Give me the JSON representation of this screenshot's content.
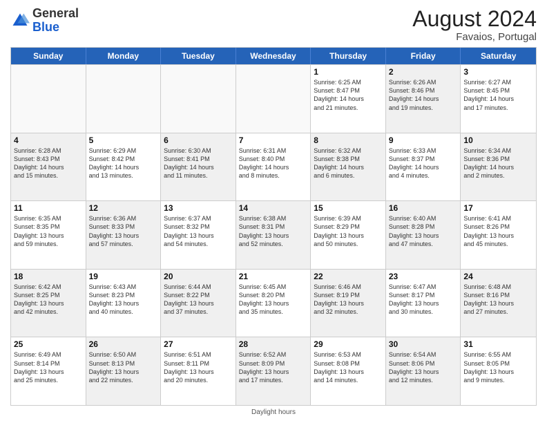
{
  "header": {
    "logo_general": "General",
    "logo_blue": "Blue",
    "month_year": "August 2024",
    "location": "Favaios, Portugal"
  },
  "footer": {
    "daylight_label": "Daylight hours"
  },
  "days_of_week": [
    "Sunday",
    "Monday",
    "Tuesday",
    "Wednesday",
    "Thursday",
    "Friday",
    "Saturday"
  ],
  "weeks": [
    [
      {
        "day": "",
        "info": "",
        "empty": true
      },
      {
        "day": "",
        "info": "",
        "empty": true
      },
      {
        "day": "",
        "info": "",
        "empty": true
      },
      {
        "day": "",
        "info": "",
        "empty": true
      },
      {
        "day": "1",
        "info": "Sunrise: 6:25 AM\nSunset: 8:47 PM\nDaylight: 14 hours\nand 21 minutes.",
        "shaded": false
      },
      {
        "day": "2",
        "info": "Sunrise: 6:26 AM\nSunset: 8:46 PM\nDaylight: 14 hours\nand 19 minutes.",
        "shaded": true
      },
      {
        "day": "3",
        "info": "Sunrise: 6:27 AM\nSunset: 8:45 PM\nDaylight: 14 hours\nand 17 minutes.",
        "shaded": false
      }
    ],
    [
      {
        "day": "4",
        "info": "Sunrise: 6:28 AM\nSunset: 8:43 PM\nDaylight: 14 hours\nand 15 minutes.",
        "shaded": true
      },
      {
        "day": "5",
        "info": "Sunrise: 6:29 AM\nSunset: 8:42 PM\nDaylight: 14 hours\nand 13 minutes.",
        "shaded": false
      },
      {
        "day": "6",
        "info": "Sunrise: 6:30 AM\nSunset: 8:41 PM\nDaylight: 14 hours\nand 11 minutes.",
        "shaded": true
      },
      {
        "day": "7",
        "info": "Sunrise: 6:31 AM\nSunset: 8:40 PM\nDaylight: 14 hours\nand 8 minutes.",
        "shaded": false
      },
      {
        "day": "8",
        "info": "Sunrise: 6:32 AM\nSunset: 8:38 PM\nDaylight: 14 hours\nand 6 minutes.",
        "shaded": true
      },
      {
        "day": "9",
        "info": "Sunrise: 6:33 AM\nSunset: 8:37 PM\nDaylight: 14 hours\nand 4 minutes.",
        "shaded": false
      },
      {
        "day": "10",
        "info": "Sunrise: 6:34 AM\nSunset: 8:36 PM\nDaylight: 14 hours\nand 2 minutes.",
        "shaded": true
      }
    ],
    [
      {
        "day": "11",
        "info": "Sunrise: 6:35 AM\nSunset: 8:35 PM\nDaylight: 13 hours\nand 59 minutes.",
        "shaded": false
      },
      {
        "day": "12",
        "info": "Sunrise: 6:36 AM\nSunset: 8:33 PM\nDaylight: 13 hours\nand 57 minutes.",
        "shaded": true
      },
      {
        "day": "13",
        "info": "Sunrise: 6:37 AM\nSunset: 8:32 PM\nDaylight: 13 hours\nand 54 minutes.",
        "shaded": false
      },
      {
        "day": "14",
        "info": "Sunrise: 6:38 AM\nSunset: 8:31 PM\nDaylight: 13 hours\nand 52 minutes.",
        "shaded": true
      },
      {
        "day": "15",
        "info": "Sunrise: 6:39 AM\nSunset: 8:29 PM\nDaylight: 13 hours\nand 50 minutes.",
        "shaded": false
      },
      {
        "day": "16",
        "info": "Sunrise: 6:40 AM\nSunset: 8:28 PM\nDaylight: 13 hours\nand 47 minutes.",
        "shaded": true
      },
      {
        "day": "17",
        "info": "Sunrise: 6:41 AM\nSunset: 8:26 PM\nDaylight: 13 hours\nand 45 minutes.",
        "shaded": false
      }
    ],
    [
      {
        "day": "18",
        "info": "Sunrise: 6:42 AM\nSunset: 8:25 PM\nDaylight: 13 hours\nand 42 minutes.",
        "shaded": true
      },
      {
        "day": "19",
        "info": "Sunrise: 6:43 AM\nSunset: 8:23 PM\nDaylight: 13 hours\nand 40 minutes.",
        "shaded": false
      },
      {
        "day": "20",
        "info": "Sunrise: 6:44 AM\nSunset: 8:22 PM\nDaylight: 13 hours\nand 37 minutes.",
        "shaded": true
      },
      {
        "day": "21",
        "info": "Sunrise: 6:45 AM\nSunset: 8:20 PM\nDaylight: 13 hours\nand 35 minutes.",
        "shaded": false
      },
      {
        "day": "22",
        "info": "Sunrise: 6:46 AM\nSunset: 8:19 PM\nDaylight: 13 hours\nand 32 minutes.",
        "shaded": true
      },
      {
        "day": "23",
        "info": "Sunrise: 6:47 AM\nSunset: 8:17 PM\nDaylight: 13 hours\nand 30 minutes.",
        "shaded": false
      },
      {
        "day": "24",
        "info": "Sunrise: 6:48 AM\nSunset: 8:16 PM\nDaylight: 13 hours\nand 27 minutes.",
        "shaded": true
      }
    ],
    [
      {
        "day": "25",
        "info": "Sunrise: 6:49 AM\nSunset: 8:14 PM\nDaylight: 13 hours\nand 25 minutes.",
        "shaded": false
      },
      {
        "day": "26",
        "info": "Sunrise: 6:50 AM\nSunset: 8:13 PM\nDaylight: 13 hours\nand 22 minutes.",
        "shaded": true
      },
      {
        "day": "27",
        "info": "Sunrise: 6:51 AM\nSunset: 8:11 PM\nDaylight: 13 hours\nand 20 minutes.",
        "shaded": false
      },
      {
        "day": "28",
        "info": "Sunrise: 6:52 AM\nSunset: 8:09 PM\nDaylight: 13 hours\nand 17 minutes.",
        "shaded": true
      },
      {
        "day": "29",
        "info": "Sunrise: 6:53 AM\nSunset: 8:08 PM\nDaylight: 13 hours\nand 14 minutes.",
        "shaded": false
      },
      {
        "day": "30",
        "info": "Sunrise: 6:54 AM\nSunset: 8:06 PM\nDaylight: 13 hours\nand 12 minutes.",
        "shaded": true
      },
      {
        "day": "31",
        "info": "Sunrise: 6:55 AM\nSunset: 8:05 PM\nDaylight: 13 hours\nand 9 minutes.",
        "shaded": false
      }
    ]
  ]
}
